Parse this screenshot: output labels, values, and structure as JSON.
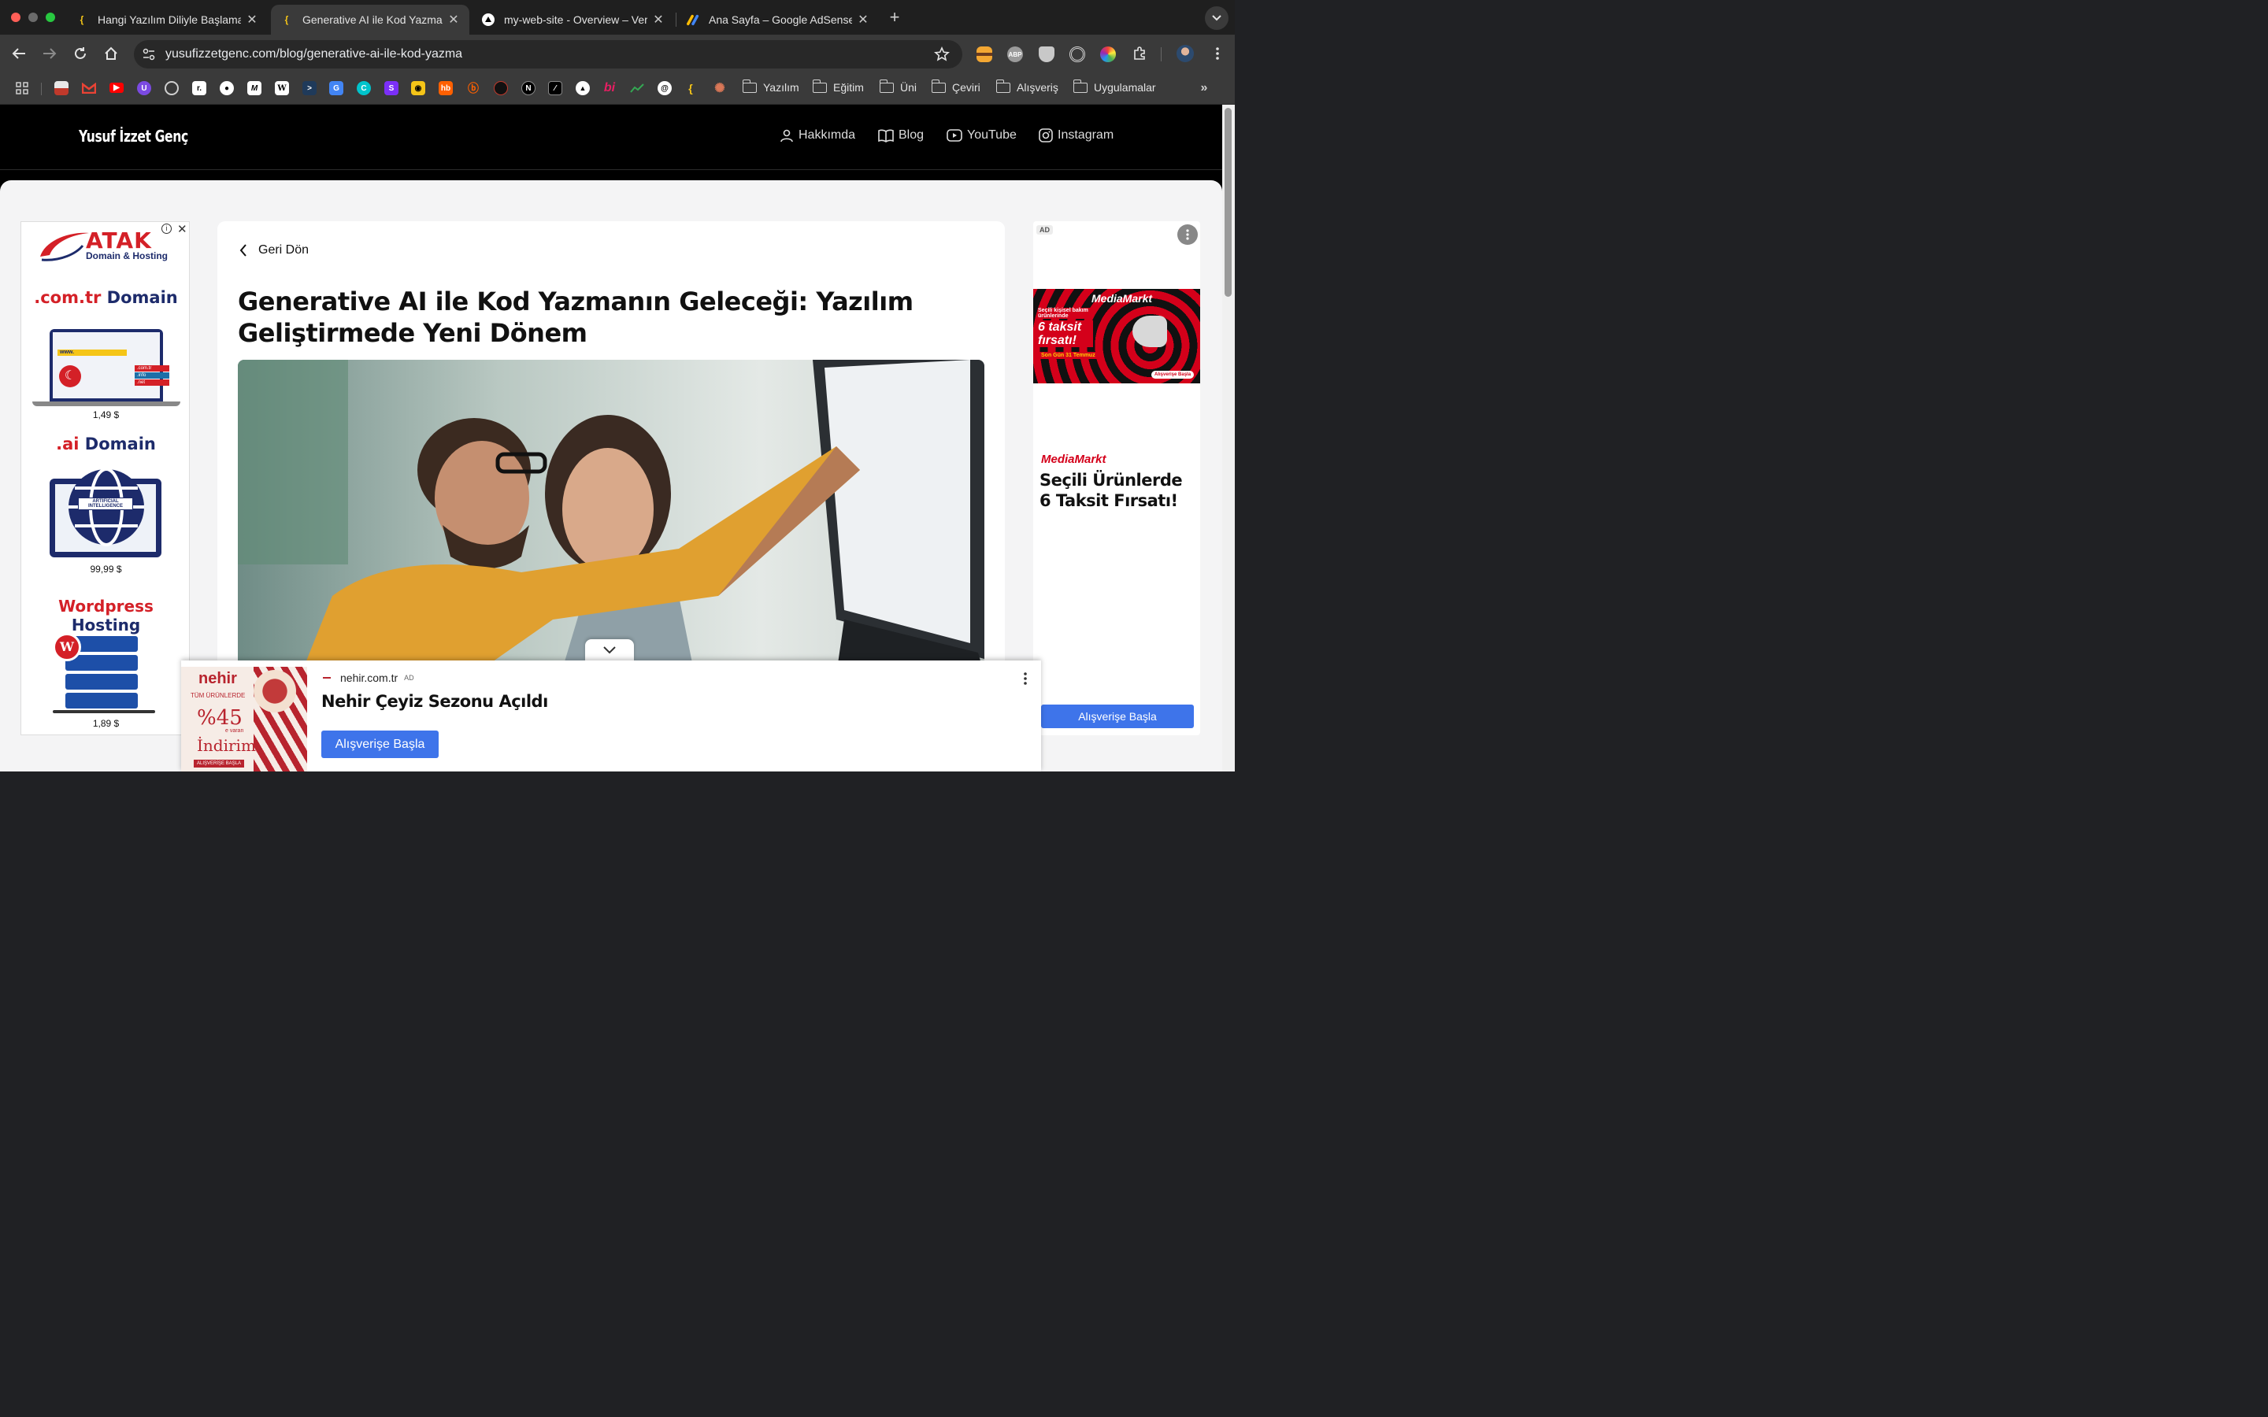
{
  "tabs": [
    {
      "title": "Hangi Yazılım Diliyle Başlamalı",
      "active": false
    },
    {
      "title": "Generative AI ile Kod Yazmanın",
      "active": true
    },
    {
      "title": "my-web-site - Overview – Vercel",
      "active": false
    },
    {
      "title": "Ana Sayfa – Google AdSense",
      "active": false
    }
  ],
  "omnibox": {
    "url": "yusufizzetgenc.com/blog/generative-ai-ile-kod-yazma"
  },
  "bookmarks": {
    "folders": [
      "Yazılım",
      "Eğitim",
      "Üni",
      "Çeviri",
      "Alışveriş",
      "Uygulamalar"
    ],
    "icon_labels": {
      "notion": "N",
      "hb": "hb",
      "bi": "bi",
      "wiki": "W",
      "s": "S"
    }
  },
  "site": {
    "logo": "Yusuf İzzet Genç",
    "nav": [
      "Hakkımda",
      "Blog",
      "YouTube",
      "Instagram"
    ]
  },
  "article": {
    "back_label": "Geri Dön",
    "title": "Generative AI ile Kod Yazmanın Geleceği: Yazılım Geliştirmede Yeni Dönem"
  },
  "left_ad": {
    "brand": "ATAK",
    "brand_sub": "Domain & Hosting",
    "offers": [
      {
        "ext": ".com.tr",
        "label": "Domain",
        "price": "1,49 $"
      },
      {
        "ext": ".ai",
        "label": "Domain",
        "price": "99,99 $"
      },
      {
        "ext": "Wordpress",
        "label": "Hosting",
        "price": "1,89 $"
      }
    ],
    "laptop_tags": [
      ".com.tr",
      ".info",
      ".net"
    ],
    "laptop_bar": "www.",
    "ai_badge": "ARTIFICIAL INTELLIGENCE"
  },
  "right_ad": {
    "badge": "AD",
    "banner_brand": "MediaMarkt",
    "banner_small": "Seçili kişisel bakım ürünlerinde",
    "banner_big": "6 taksit fırsatı!",
    "banner_date": "Son Gün 31 Temmuz",
    "banner_cta": "Alışverişe Başla",
    "brand": "MediaMarkt",
    "headline": "Seçili Ürünlerde 6 Taksit Fırsatı!",
    "cta": "Alışverişe Başla"
  },
  "anchor_ad": {
    "domain": "nehir.com.tr",
    "badge": "AD",
    "headline": "Nehir Çeyiz Sezonu Açıldı",
    "cta": "Alışverişe Başla",
    "img_brand": "nehir",
    "img_line1": "TÜM ÜRÜNLERDE",
    "img_pct": "%45",
    "img_line2": "e varan",
    "img_line3": "İndirim",
    "img_cta": "ALIŞVERİŞE BAŞLA"
  }
}
